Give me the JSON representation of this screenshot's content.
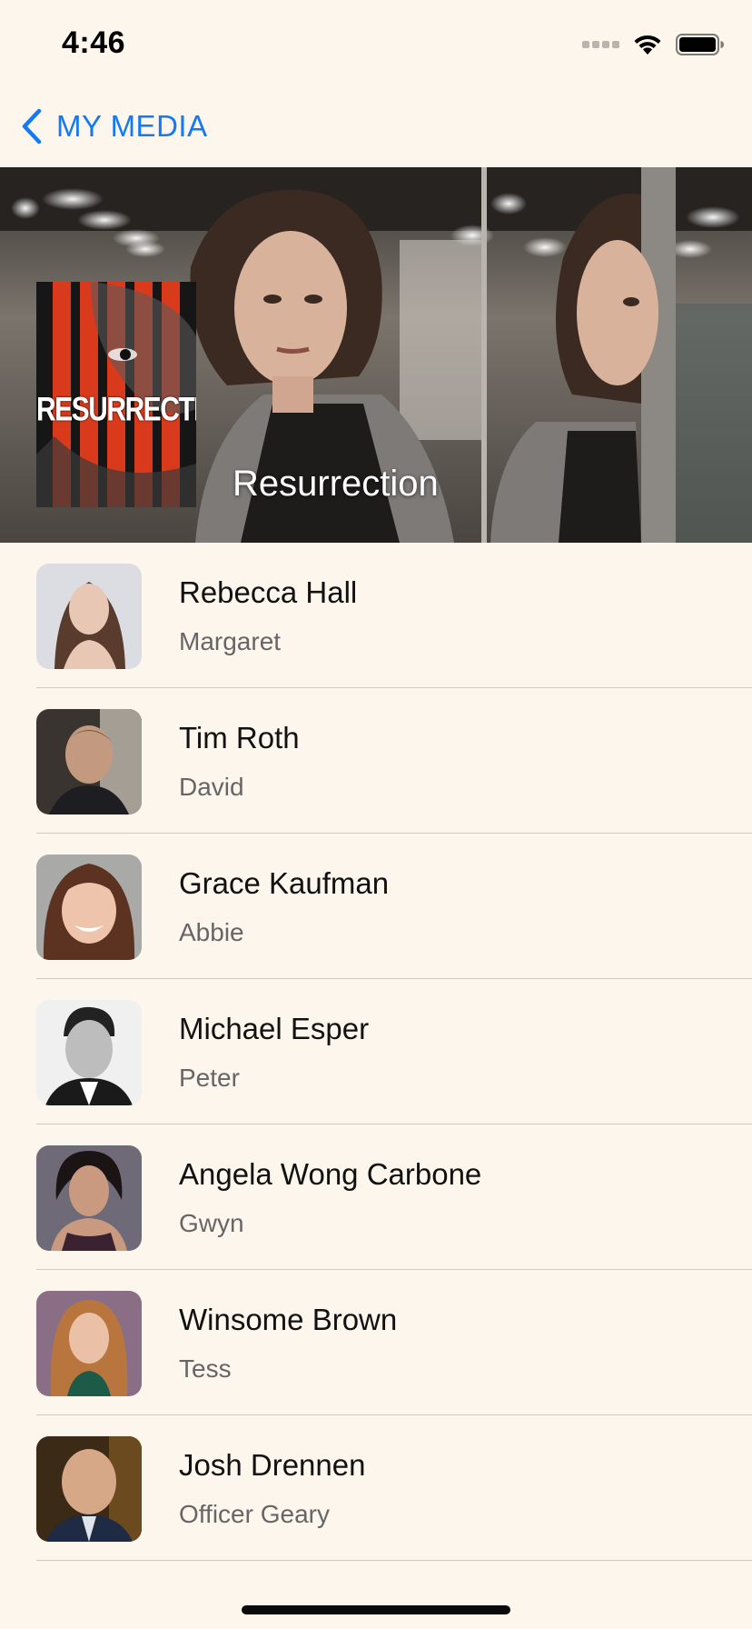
{
  "status_bar": {
    "time": "4:46",
    "icons": [
      "signal-icon",
      "wifi-icon",
      "battery-icon"
    ]
  },
  "nav": {
    "back_label": "MY MEDIA",
    "accent_color": "#1479f5"
  },
  "hero": {
    "title": "Resurrection",
    "poster_title": "RESURRECTION"
  },
  "cast": [
    {
      "name": "Rebecca Hall",
      "role": "Margaret"
    },
    {
      "name": "Tim Roth",
      "role": "David"
    },
    {
      "name": "Grace Kaufman",
      "role": "Abbie"
    },
    {
      "name": "Michael Esper",
      "role": "Peter"
    },
    {
      "name": "Angela Wong Carbone",
      "role": "Gwyn"
    },
    {
      "name": "Winsome Brown",
      "role": "Tess"
    },
    {
      "name": "Josh Drennen",
      "role": "Officer Geary"
    }
  ]
}
